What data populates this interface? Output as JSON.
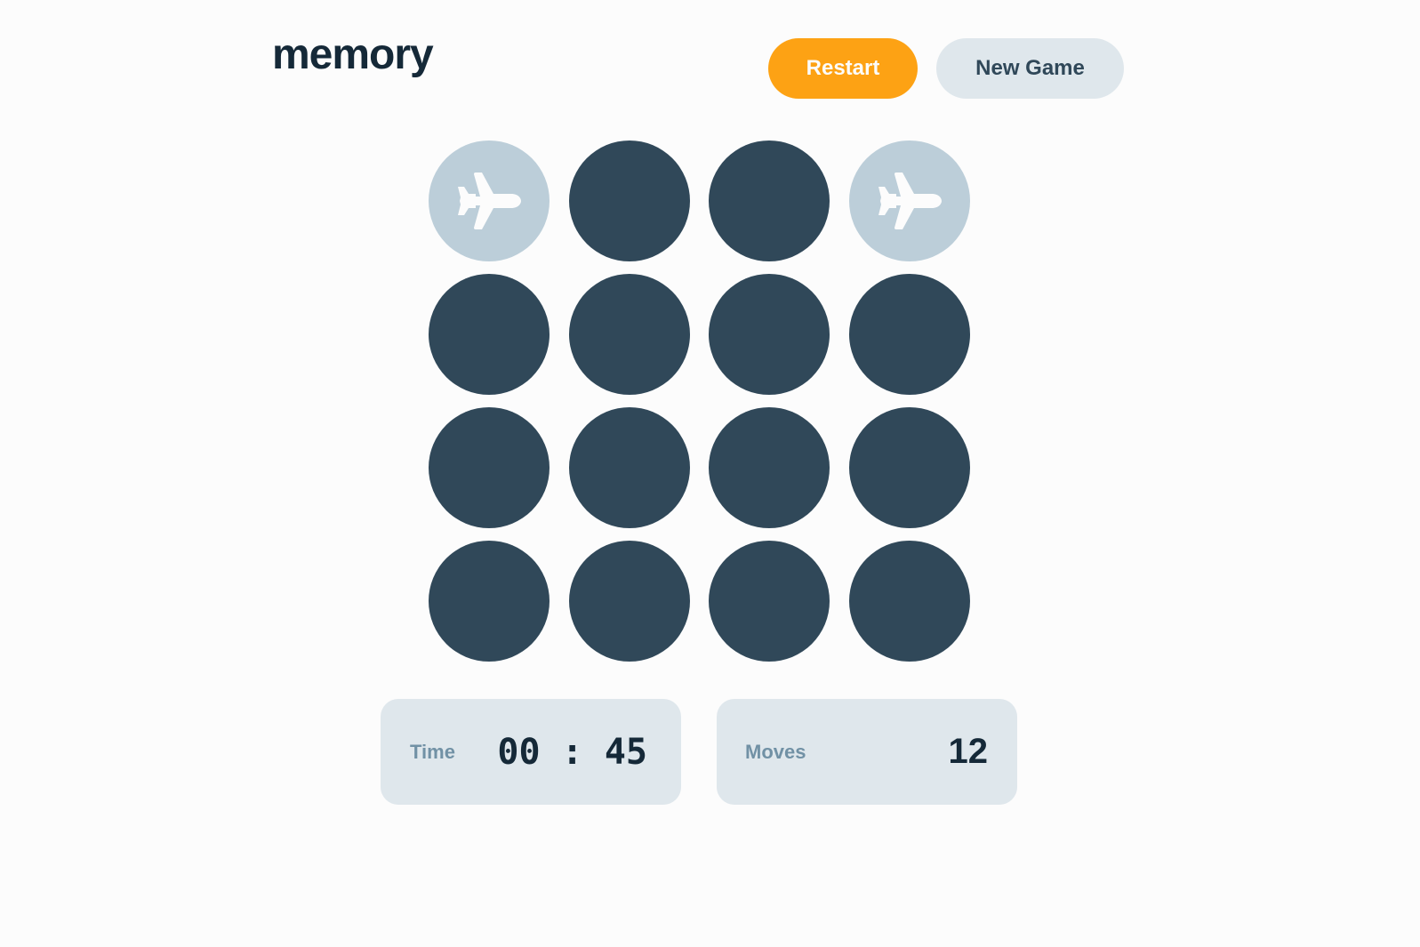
{
  "header": {
    "logo": "memory",
    "restart_label": "Restart",
    "new_game_label": "New Game"
  },
  "board": {
    "rows": 4,
    "cols": 4,
    "tiles": [
      {
        "state": "open",
        "icon": "plane-icon"
      },
      {
        "state": "hidden"
      },
      {
        "state": "hidden"
      },
      {
        "state": "open",
        "icon": "plane-icon"
      },
      {
        "state": "hidden"
      },
      {
        "state": "hidden"
      },
      {
        "state": "hidden"
      },
      {
        "state": "hidden"
      },
      {
        "state": "hidden"
      },
      {
        "state": "hidden"
      },
      {
        "state": "hidden"
      },
      {
        "state": "hidden"
      },
      {
        "state": "hidden"
      },
      {
        "state": "hidden"
      },
      {
        "state": "hidden"
      },
      {
        "state": "hidden"
      }
    ]
  },
  "stats": {
    "time_label": "Time",
    "time_value": "00 : 45",
    "moves_label": "Moves",
    "moves_value": "12"
  },
  "colors": {
    "accent": "#fda214",
    "hidden_tile": "#304859",
    "open_tile": "#bcced9",
    "panel": "#dfe7ec",
    "text_dark": "#152938"
  }
}
